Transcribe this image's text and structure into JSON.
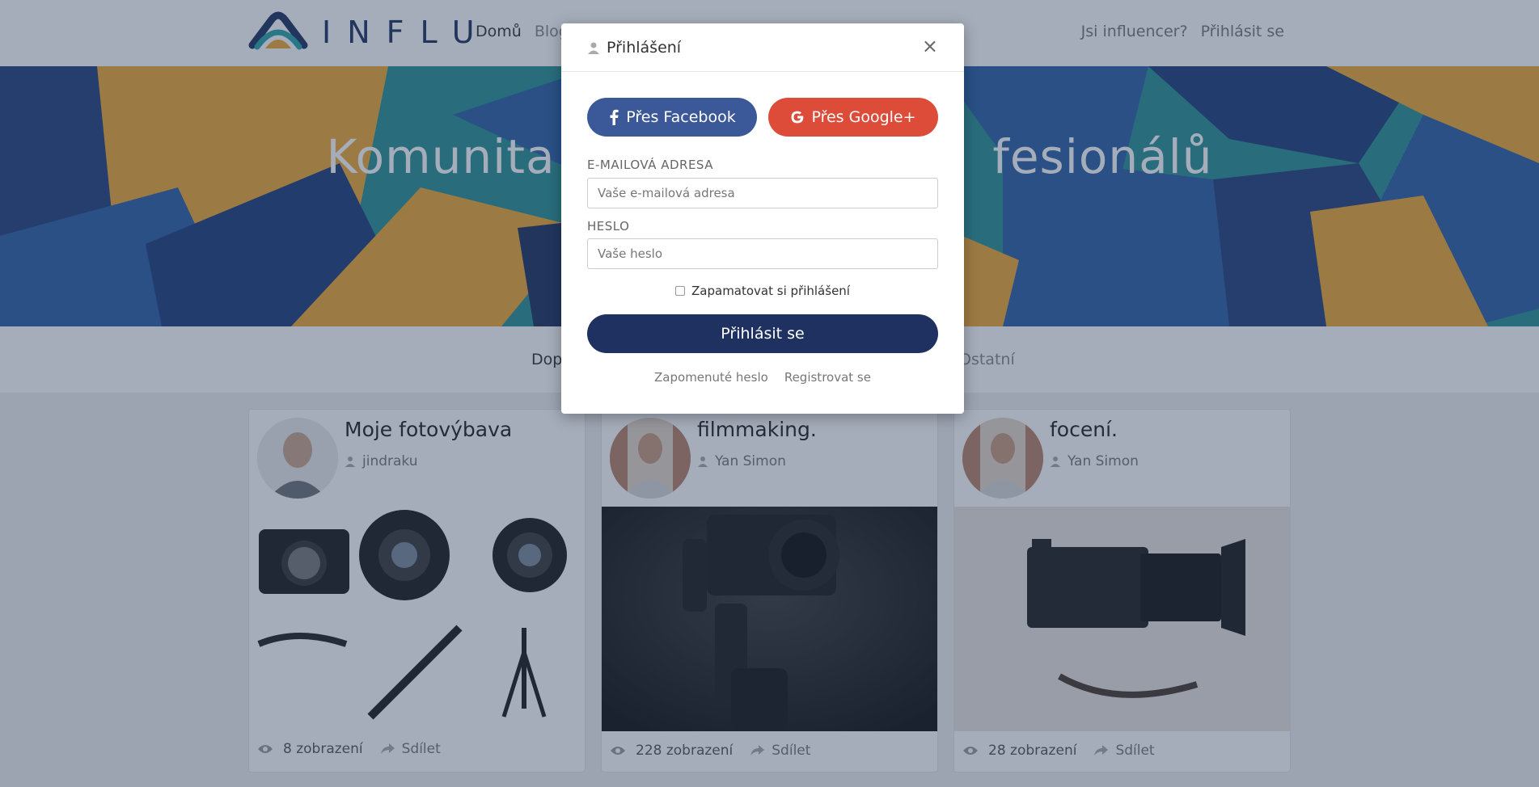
{
  "header": {
    "brand": "INFLU",
    "nav": {
      "home": "Domů",
      "blog": "Blog"
    },
    "right": {
      "influencer": "Jsi influencer?",
      "login": "Přihlásit se"
    }
  },
  "hero": {
    "title_left": "Komunita",
    "title_right": "fesionálů"
  },
  "categories": {
    "first": "Dop",
    "last": "Ostatní"
  },
  "cards": [
    {
      "title": "Moje fotovýbava",
      "author": "jindraku",
      "views": "8 zobrazení",
      "share": "Sdílet"
    },
    {
      "title": "filmmaking.",
      "author": "Yan Simon",
      "views": "228 zobrazení",
      "share": "Sdílet"
    },
    {
      "title": "focení.",
      "author": "Yan Simon",
      "views": "28 zobrazení",
      "share": "Sdílet"
    }
  ],
  "modal": {
    "title": "Přihlášení",
    "close": "×",
    "facebook": "Přes Facebook",
    "google": "Přes Google+",
    "email_label": "E-MAILOVÁ ADRESA",
    "email_placeholder": "Vaše e-mailová adresa",
    "password_label": "HESLO",
    "password_placeholder": "Vaše heslo",
    "remember": "Zapamatovat si přihlášení",
    "submit": "Přihlásit se",
    "forgot": "Zapomenuté heslo",
    "register": "Registrovat se"
  },
  "colors": {
    "brand_navy": "#1e3160",
    "facebook": "#3b5998",
    "google": "#dd4b39"
  }
}
